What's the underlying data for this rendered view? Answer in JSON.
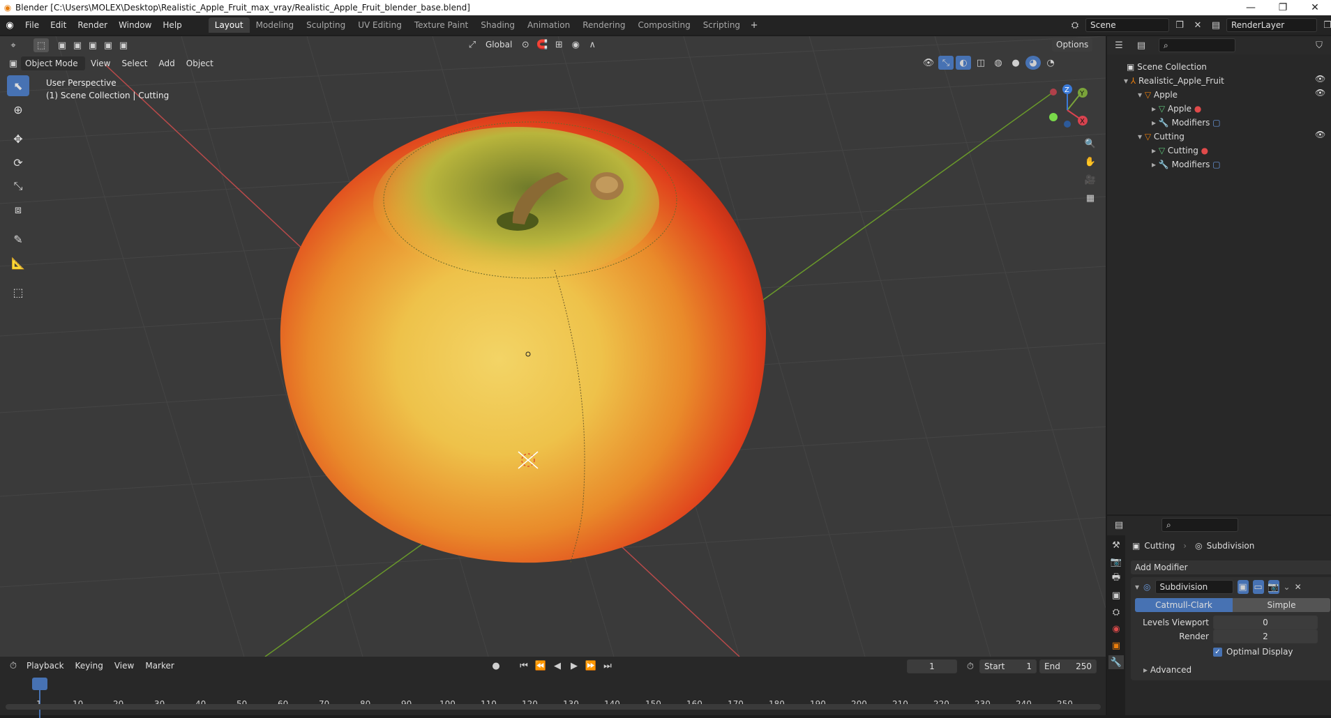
{
  "window": {
    "title": "Blender [C:\\Users\\MOLEX\\Desktop\\Realistic_Apple_Fruit_max_vray/Realistic_Apple_Fruit_blender_base.blend]"
  },
  "menus": [
    "File",
    "Edit",
    "Render",
    "Window",
    "Help"
  ],
  "workspaces": [
    "Layout",
    "Modeling",
    "Sculpting",
    "UV Editing",
    "Texture Paint",
    "Shading",
    "Animation",
    "Rendering",
    "Compositing",
    "Scripting"
  ],
  "scene": {
    "name": "Scene",
    "render_layer": "RenderLayer"
  },
  "viewport": {
    "mode": "Object Mode",
    "menus": [
      "View",
      "Select",
      "Add",
      "Object"
    ],
    "transform": "Global",
    "options_label": "Options",
    "perspective": "User Perspective",
    "collection_info": "(1) Scene Collection | Cutting"
  },
  "gizmo": {
    "x": "X",
    "y": "Y",
    "z": "Z"
  },
  "outliner": {
    "root": "Scene Collection",
    "items": [
      {
        "label": "Realistic_Apple_Fruit",
        "depth": 0,
        "icon": "empty-icon"
      },
      {
        "label": "Apple",
        "depth": 1,
        "icon": "mesh-object-icon"
      },
      {
        "label": "Apple",
        "depth": 2,
        "icon": "mesh-data-icon"
      },
      {
        "label": "Modifiers",
        "depth": 2,
        "icon": "wrench-icon"
      },
      {
        "label": "Cutting",
        "depth": 1,
        "icon": "mesh-object-icon"
      },
      {
        "label": "Cutting",
        "depth": 2,
        "icon": "mesh-data-icon"
      },
      {
        "label": "Modifiers",
        "depth": 2,
        "icon": "wrench-icon"
      }
    ]
  },
  "properties": {
    "object": "Cutting",
    "modifier_context": "Subdivision",
    "add_modifier": "Add Modifier",
    "modifier_name": "Subdivision",
    "type_options": [
      "Catmull-Clark",
      "Simple"
    ],
    "selected_type": "Catmull-Clark",
    "levels_viewport_label": "Levels Viewport",
    "levels_viewport": "0",
    "render_label": "Render",
    "render": "2",
    "optimal_display": "Optimal Display",
    "advanced": "Advanced"
  },
  "timeline": {
    "menus": [
      "Playback",
      "Keying",
      "View",
      "Marker"
    ],
    "current_frame": "1",
    "start_label": "Start",
    "start": "1",
    "end_label": "End",
    "end": "250",
    "ticks": [
      "1",
      "10",
      "20",
      "30",
      "40",
      "50",
      "60",
      "70",
      "80",
      "90",
      "100",
      "110",
      "120",
      "130",
      "140",
      "150",
      "160",
      "170",
      "180",
      "190",
      "200",
      "210",
      "220",
      "230",
      "240",
      "250"
    ]
  },
  "colors": {
    "accent": "#4772b3",
    "orange": "#e87d0d"
  }
}
